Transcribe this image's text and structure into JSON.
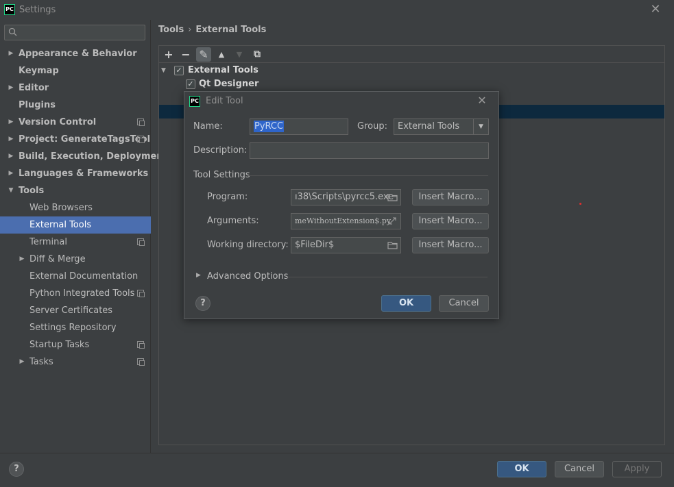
{
  "window": {
    "title": "Settings",
    "app_icon": "PC"
  },
  "search": {
    "placeholder": ""
  },
  "sidebar": {
    "items": [
      {
        "label": "Appearance & Behavior",
        "arrow": "▶",
        "bold": true,
        "level": 0
      },
      {
        "label": "Keymap",
        "arrow": "",
        "bold": true,
        "level": 0
      },
      {
        "label": "Editor",
        "arrow": "▶",
        "bold": true,
        "level": 0
      },
      {
        "label": "Plugins",
        "arrow": "",
        "bold": true,
        "level": 0
      },
      {
        "label": "Version Control",
        "arrow": "▶",
        "bold": true,
        "level": 0,
        "project": true
      },
      {
        "label": "Project: GenerateTagsTool",
        "arrow": "▶",
        "bold": true,
        "level": 0,
        "project": true
      },
      {
        "label": "Build, Execution, Deployment",
        "arrow": "▶",
        "bold": true,
        "level": 0
      },
      {
        "label": "Languages & Frameworks",
        "arrow": "▶",
        "bold": true,
        "level": 0
      },
      {
        "label": "Tools",
        "arrow": "▼",
        "bold": true,
        "level": 0
      },
      {
        "label": "Web Browsers",
        "arrow": "",
        "bold": false,
        "level": 1
      },
      {
        "label": "External Tools",
        "arrow": "",
        "bold": false,
        "level": 1,
        "selected": true
      },
      {
        "label": "Terminal",
        "arrow": "",
        "bold": false,
        "level": 1,
        "project": true
      },
      {
        "label": "Diff & Merge",
        "arrow": "▶",
        "bold": false,
        "level": 1
      },
      {
        "label": "External Documentation",
        "arrow": "",
        "bold": false,
        "level": 1
      },
      {
        "label": "Python Integrated Tools",
        "arrow": "",
        "bold": false,
        "level": 1,
        "project": true
      },
      {
        "label": "Server Certificates",
        "arrow": "",
        "bold": false,
        "level": 1
      },
      {
        "label": "Settings Repository",
        "arrow": "",
        "bold": false,
        "level": 1
      },
      {
        "label": "Startup Tasks",
        "arrow": "",
        "bold": false,
        "level": 1,
        "project": true
      },
      {
        "label": "Tasks",
        "arrow": "▶",
        "bold": false,
        "level": 1,
        "project": true
      }
    ]
  },
  "breadcrumb": {
    "first": "Tools",
    "sep": "›",
    "second": "External Tools"
  },
  "toolbar": {
    "add": "+",
    "remove": "−",
    "edit": "✎",
    "up": "▲",
    "down": "▼",
    "copy": "⧉"
  },
  "tools_tree": {
    "group": "External Tools",
    "item": "Qt Designer",
    "group_arrow": "▼",
    "check": "✓"
  },
  "dialog": {
    "title": "Edit Tool",
    "icon": "PC",
    "close": "✕",
    "name_label": "Name:",
    "name_value": "PyRCC",
    "group_label": "Group:",
    "group_value": "External Tools",
    "description_label": "Description:",
    "description_value": "",
    "tool_settings_title": "Tool Settings",
    "program_label": "Program:",
    "program_value": "ı38\\Scripts\\pyrcc5.exe",
    "arguments_label": "Arguments:",
    "arguments_value": "meWithoutExtension$.py",
    "workdir_label": "Working directory:",
    "workdir_value": "$FileDir$",
    "insert_macro": "Insert Macro...",
    "advanced_options": "Advanced Options",
    "advanced_arrow": "▶",
    "help": "?",
    "ok": "OK",
    "cancel": "Cancel"
  },
  "footer": {
    "help": "?",
    "ok": "OK",
    "cancel": "Cancel",
    "apply": "Apply"
  },
  "colors": {
    "selection": "#4b6eaf",
    "primary_button": "#365880",
    "background": "#3c3f41"
  }
}
